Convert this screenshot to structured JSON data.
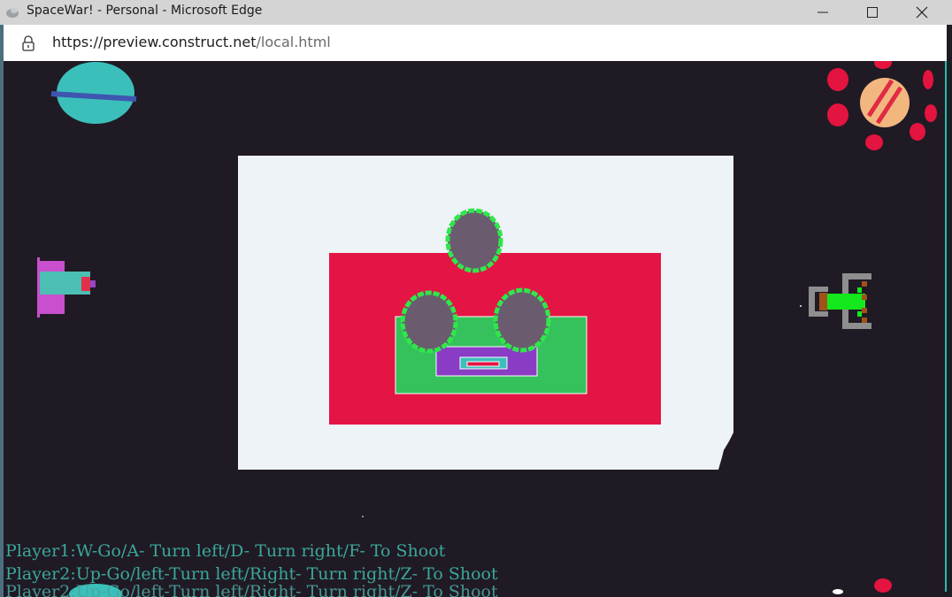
{
  "window": {
    "title": "SpaceWar! - Personal - Microsoft Edge",
    "controls": [
      "minimize-icon",
      "maximize-icon",
      "close-icon"
    ]
  },
  "address_bar": {
    "url_host": "https://preview.construct.net",
    "url_path": "/local.html",
    "icon": "lock-icon"
  },
  "game": {
    "instructions": {
      "player1": "Player1:W-Go/A- Turn left/D- Turn right/F- To Shoot",
      "player2": "Player2:Up-Go/left-Turn left/Right- Turn right/Z- To Shoot"
    },
    "colors": {
      "background": "#201a24",
      "board": "#eef3f7",
      "red_panel": "#e41444",
      "green_panel": "#35c15c",
      "purple_panel": "#8a3cc4",
      "asteroid_fill": "#6b5b6e",
      "asteroid_outline": "#2ee84a",
      "hud_text": "#3aa79a"
    },
    "sprites": [
      "planet-teal",
      "planet-orange-with-moons",
      "player1-ship",
      "player2-ship",
      "asteroid",
      "asteroid",
      "asteroid"
    ]
  }
}
